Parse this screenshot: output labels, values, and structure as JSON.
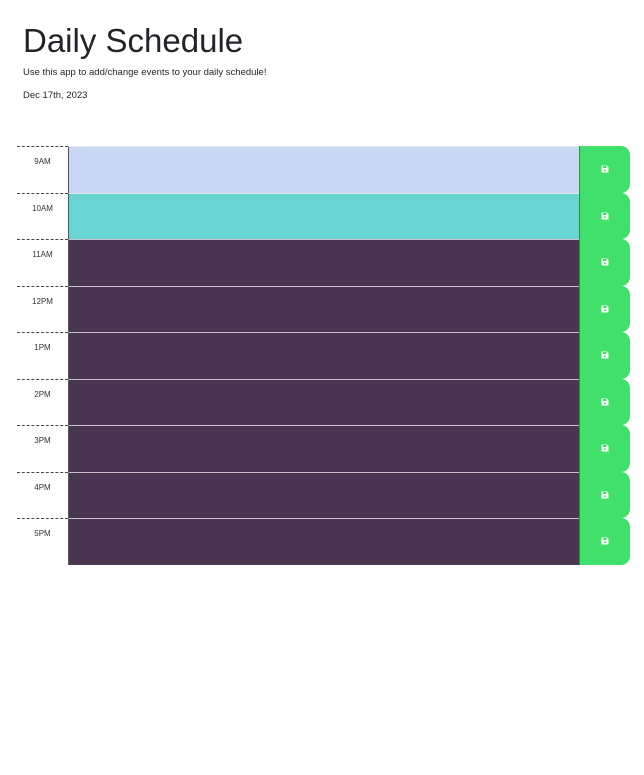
{
  "header": {
    "title": "Daily Schedule",
    "lead": "Use this app to add/change events to your daily schedule!",
    "current_day": "Dec 17th, 2023"
  },
  "schedule": {
    "rows": [
      {
        "hour": "9AM",
        "status": "future",
        "text": ""
      },
      {
        "hour": "10AM",
        "status": "present",
        "text": ""
      },
      {
        "hour": "11AM",
        "status": "past",
        "text": ""
      },
      {
        "hour": "12PM",
        "status": "past",
        "text": ""
      },
      {
        "hour": "1PM",
        "status": "past",
        "text": ""
      },
      {
        "hour": "2PM",
        "status": "past",
        "text": ""
      },
      {
        "hour": "3PM",
        "status": "past",
        "text": ""
      },
      {
        "hour": "4PM",
        "status": "past",
        "text": ""
      },
      {
        "hour": "5PM",
        "status": "past",
        "text": ""
      }
    ],
    "save_icon": "floppy-disk-icon"
  },
  "colors": {
    "past": "#4a3653",
    "present": "#69d5d3",
    "future": "#c9d7f5",
    "save": "#40e06a"
  }
}
